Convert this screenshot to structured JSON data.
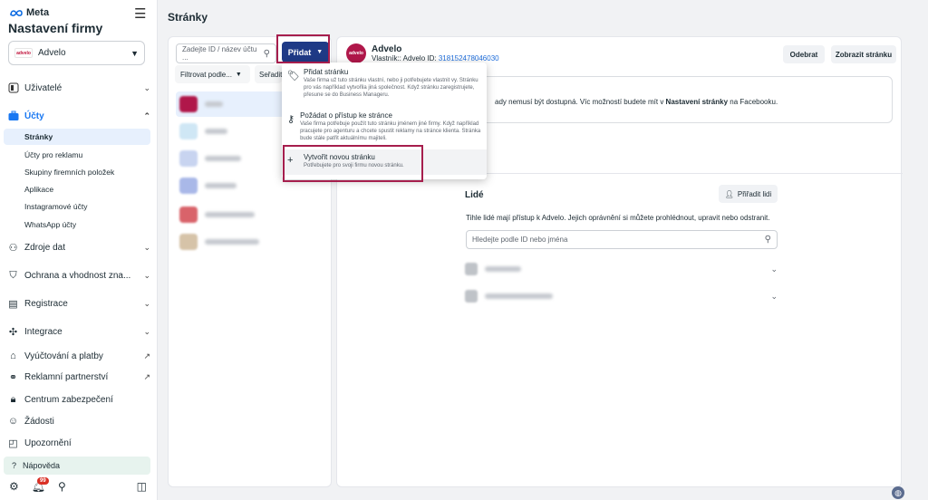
{
  "brand": {
    "name": "Meta"
  },
  "sidebar": {
    "title": "Nastavení firmy",
    "business": {
      "name": "Advelo",
      "logo_text": "advelo"
    },
    "items": [
      {
        "label": "Uživatelé",
        "icon": "users-icon",
        "expandable": true
      },
      {
        "label": "Účty",
        "icon": "briefcase-icon",
        "expandable": true,
        "expanded": true
      },
      {
        "label": "Zdroje dat",
        "icon": "data-sources-icon",
        "expandable": true
      },
      {
        "label": "Ochrana a vhodnost zna...",
        "icon": "shield-icon",
        "expandable": true
      },
      {
        "label": "Registrace",
        "icon": "registration-icon",
        "expandable": true
      },
      {
        "label": "Integrace",
        "icon": "integrations-icon",
        "expandable": true
      },
      {
        "label": "Vyúčtování a platby",
        "icon": "billing-icon",
        "external": true
      },
      {
        "label": "Reklamní partnerství",
        "icon": "handshake-icon",
        "external": true
      },
      {
        "label": "Centrum zabezpečení",
        "icon": "lock-icon"
      },
      {
        "label": "Žádosti",
        "icon": "person-request-icon"
      },
      {
        "label": "Upozornění",
        "icon": "notification-icon"
      }
    ],
    "sub_items": [
      {
        "label": "Stránky",
        "active": true
      },
      {
        "label": "Účty pro reklamu"
      },
      {
        "label": "Skupiny firemních položek"
      },
      {
        "label": "Aplikace"
      },
      {
        "label": "Instagramové účty"
      },
      {
        "label": "WhatsApp účty"
      }
    ],
    "help": "Nápověda",
    "notification_count": "99"
  },
  "main": {
    "title": "Stránky",
    "search_placeholder": "Zadejte ID / název účtu ...",
    "add_button": "Přidat",
    "filter_label": "Filtrovat podle...",
    "sort_label": "Seřadit",
    "page": {
      "name": "Advelo",
      "owner_label": "Vlastník:: Advelo",
      "id_label": "ID:",
      "id_value": "318152478046030",
      "remove_button": "Odebrat",
      "view_button": "Zobrazit stránku",
      "info_text_pre": "ady nemusí být dostupná. Víc možností budete mít v ",
      "info_text_bold": "Nastavení stránky",
      "info_text_post": " na Facebooku."
    },
    "people": {
      "title": "Lidé",
      "assign_button": "Přiřadit lidi",
      "description": "Tihle lidé mají přístup k Advelo. Jejich oprávnění si můžete prohlédnout, upravit nebo odstranit.",
      "search_placeholder": "Hledejte podle ID nebo jména"
    }
  },
  "dropdown": {
    "items": [
      {
        "title": "Přidat stránku",
        "icon": "tag-icon",
        "description": "Vaše firma už tuto stránku vlastní, nebo ji potřebujete vlastnit vy. Stránku pro vás například vytvořila jiná společnost. Když stránku zaregistrujete, přesune se do Business Manageru."
      },
      {
        "title": "Požádat o přístup ke stránce",
        "icon": "key-icon",
        "description": "Vaše firma potřebuje použít tuto stránku jménem jiné firmy. Když například pracujete pro agenturu a chcete spustit reklamy na stránce klienta. Stránka bude stále patřit aktuálnímu majiteli."
      },
      {
        "title": "Vytvořit novou stránku",
        "icon": "plus-icon",
        "description": "Potřebujete pro svoji firmu novou stránku."
      }
    ]
  },
  "colors": {
    "accent": "#1f3a86",
    "highlight": "#a61e4d",
    "active_bg": "#e7f0fd",
    "brand_badge": "#b0174a"
  }
}
